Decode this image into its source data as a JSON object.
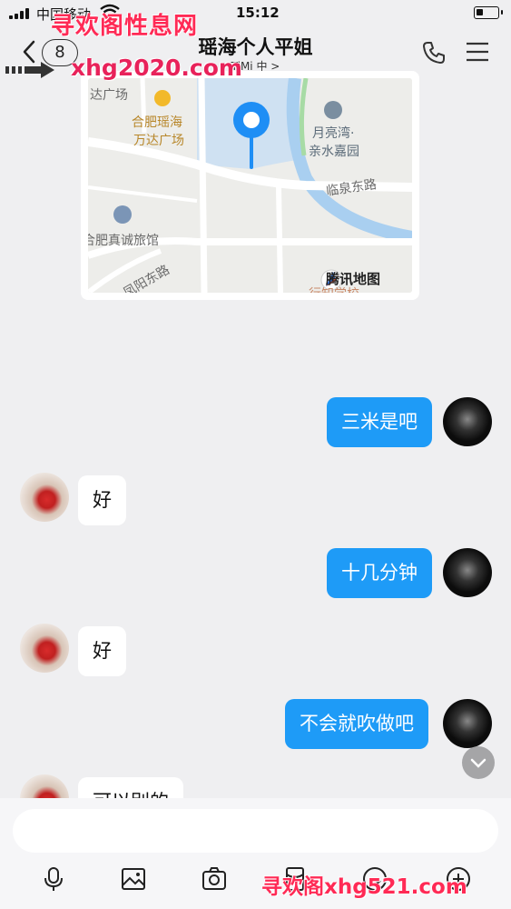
{
  "status_bar": {
    "carrier": "中国移动",
    "time": "15:12",
    "battery_level": 0.35
  },
  "header": {
    "unread_count": "8",
    "title": "瑶海个人平姐",
    "subtitle": "TiMi 中 >"
  },
  "watermarks": {
    "top_line1": "寻欢阁性息网",
    "top_line2": "xhg2020.com",
    "bottom": "寻欢阁xhg521.com"
  },
  "map": {
    "brand": "腾讯地图",
    "labels": {
      "a": "达广场",
      "b": "合肥瑶海",
      "c": "万达广场",
      "d": "月亮湾·",
      "e": "亲水嘉园",
      "f": "临泉东路",
      "g": "合肥真诚旅馆",
      "h": "凤阳东路",
      "i": "行知学校"
    }
  },
  "messages": [
    {
      "side": "out",
      "text": "三米是吧"
    },
    {
      "side": "in",
      "text": "好"
    },
    {
      "side": "out",
      "text": "十几分钟"
    },
    {
      "side": "in",
      "text": "好"
    },
    {
      "side": "out",
      "text": "不会就吹做吧"
    },
    {
      "side": "in",
      "text": "可以别的"
    }
  ],
  "composer": {
    "input_value": "",
    "tools": [
      "microphone-icon",
      "image-icon",
      "camera-icon",
      "red-packet-icon",
      "emoji-icon",
      "plus-icon"
    ]
  },
  "colors": {
    "outgoing_bubble": "#1e9bf7",
    "incoming_bubble": "#ffffff",
    "background": "#efeff1"
  }
}
